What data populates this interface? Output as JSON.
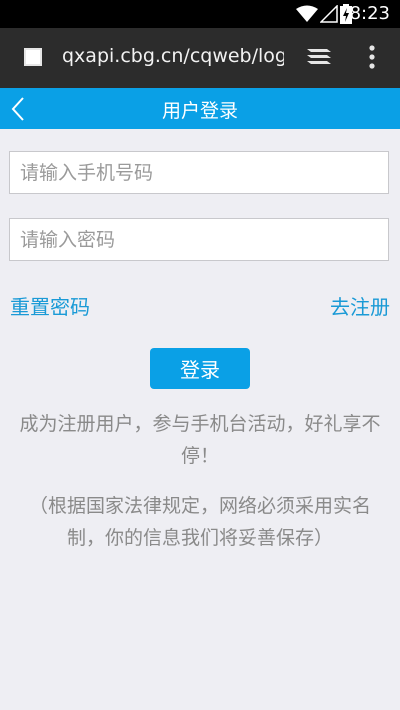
{
  "status_bar": {
    "time": "8:23"
  },
  "browser": {
    "url": "qxapi.cbg.cn/cqweb/logi"
  },
  "header": {
    "title": "用户登录"
  },
  "form": {
    "phone_placeholder": "请输入手机号码",
    "password_placeholder": "请输入密码",
    "reset_password": "重置密码",
    "register": "去注册",
    "login_button": "登录"
  },
  "notes": {
    "promo": "成为注册用户，参与手机台活动，好礼享不停！",
    "privacy": "（根据国家法律规定，网络必须采用实名制，你的信息我们将妥善保存）"
  },
  "colors": {
    "accent": "#0aa0e6",
    "link": "#1a9ad6",
    "background": "#eeeef3"
  }
}
